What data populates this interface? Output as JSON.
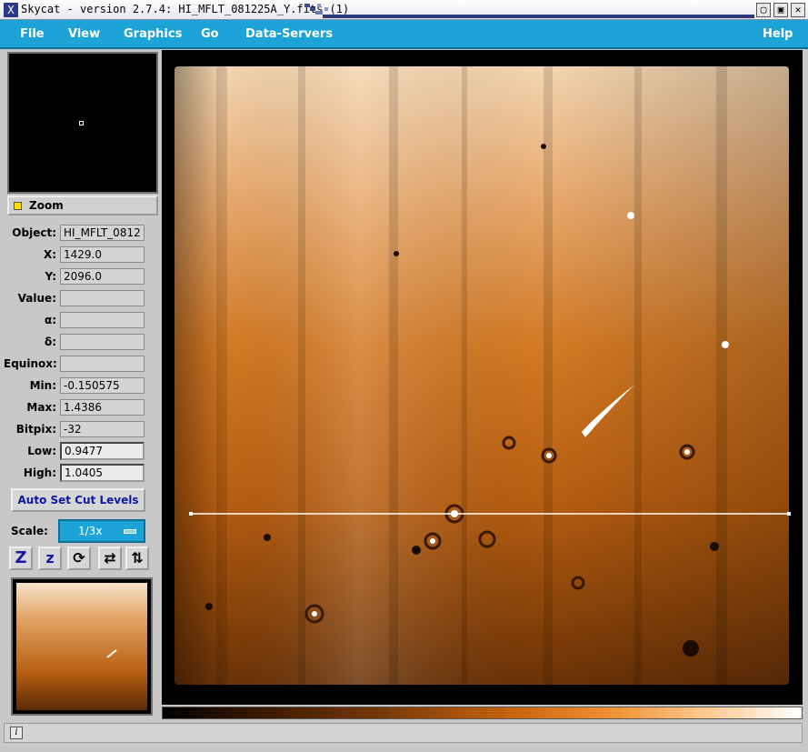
{
  "window": {
    "title": "Skycat - version 2.7.4: HI_MFLT_081225A_Y.fits (1)",
    "app_icon": "X",
    "controls": [
      "▢",
      "▣",
      "✕"
    ]
  },
  "menu": {
    "file": "File",
    "view": "View",
    "graphics": "Graphics",
    "go": "Go",
    "data_servers": "Data-Servers",
    "help": "Help"
  },
  "zoom": {
    "label": "Zoom",
    "checked": true
  },
  "info": {
    "object": {
      "label": "Object:",
      "value": "HI_MFLT_0812"
    },
    "x": {
      "label": "X:",
      "value": "1429.0"
    },
    "y": {
      "label": "Y:",
      "value": "2096.0"
    },
    "value": {
      "label": "Value:",
      "value": ""
    },
    "alpha": {
      "label": "α:",
      "value": ""
    },
    "delta": {
      "label": "δ:",
      "value": ""
    },
    "equinox": {
      "label": "Equinox:",
      "value": ""
    },
    "min": {
      "label": "Min:",
      "value": "-0.150575"
    },
    "max": {
      "label": "Max:",
      "value": "1.4386"
    },
    "bitpix": {
      "label": "Bitpix:",
      "value": "-32"
    },
    "low": {
      "label": "Low:",
      "value": "0.9477"
    },
    "high": {
      "label": "High:",
      "value": "1.0405"
    }
  },
  "controls": {
    "auto_cut": "Auto Set Cut Levels",
    "scale_label": "Scale:",
    "scale_value": "1/3x"
  },
  "tools": {
    "zoom_in": "Z",
    "zoom_out": "z",
    "rotate": "⟳",
    "flip_x": "⇄",
    "flip_y": "⇅"
  },
  "status": {
    "icon": "i",
    "text": ""
  },
  "colors": {
    "menu_bg": "#1ca4d8",
    "image_orange": "#d87018",
    "text_blue": "#0a1a9c"
  }
}
